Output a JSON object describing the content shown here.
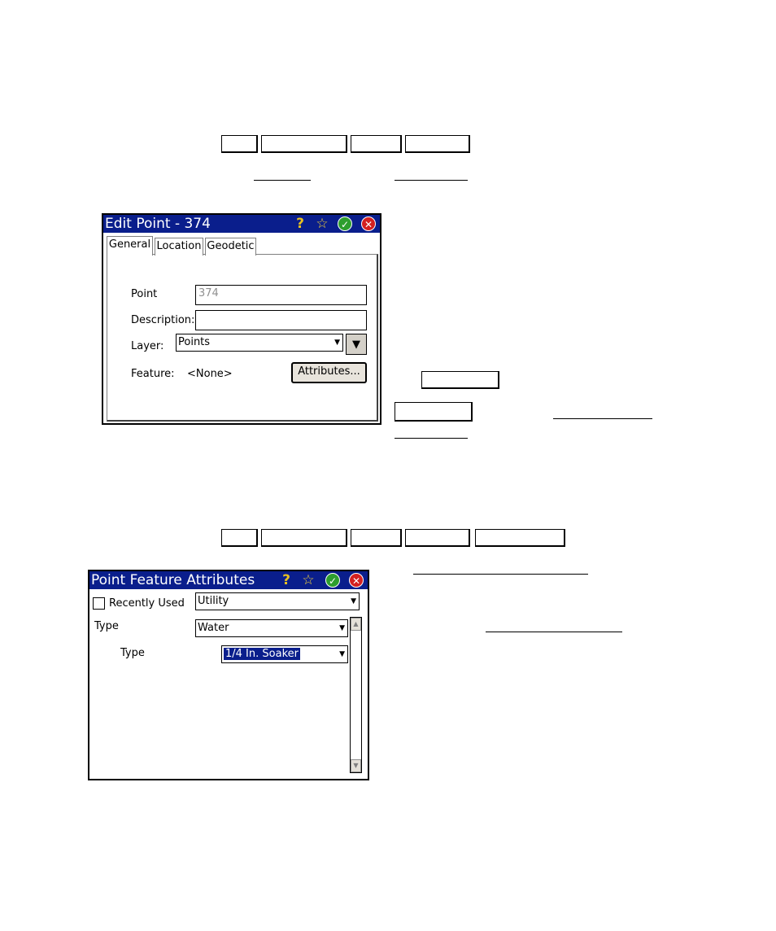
{
  "edit_point": {
    "title": "Edit Point - 374",
    "tabs": [
      {
        "label": "General"
      },
      {
        "label": "Location"
      },
      {
        "label": "Geodetic"
      }
    ],
    "fields": {
      "point_label": "Point",
      "point_value": "374",
      "description_label": "Description:",
      "description_value": "",
      "layer_label": "Layer:",
      "layer_value": "Points",
      "feature_label": "Feature:",
      "feature_value": "<None>"
    },
    "attributes_button": "Attributes..."
  },
  "feature_attributes": {
    "title": "Point Feature Attributes",
    "recently_used_label": "Recently Used",
    "category_value": "Utility",
    "type_label": "Type",
    "type_value": "Water",
    "subtype_label": "Type",
    "subtype_value": "1/4 In. Soaker"
  },
  "icons": {
    "help": "help-icon",
    "favorite": "star-icon",
    "ok": "checkmark-icon",
    "cancel": "close-icon"
  },
  "colors": {
    "titlebar": "#0a1e8c",
    "ok": "#2e9e2e",
    "cancel": "#d42020"
  }
}
